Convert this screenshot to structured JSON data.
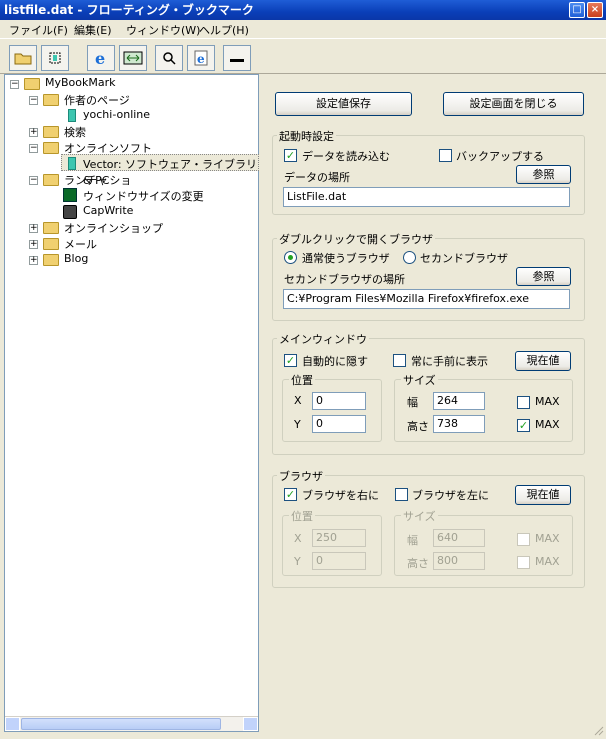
{
  "window": {
    "title": "listfile.dat - フローティング・ブックマーク"
  },
  "menu": [
    "ファイル(F)",
    "編集(E)",
    "ウィンドウ(W)",
    "ヘルプ(H)"
  ],
  "tree": {
    "root": "MyBookMark",
    "items": [
      {
        "label": "作者のページ"
      },
      {
        "label": "yochi-online"
      },
      {
        "label": "検索"
      },
      {
        "label": "オンラインソフト"
      },
      {
        "label": "Vector: ソフトウェア・ライブラリ & PCショ"
      },
      {
        "label": "ランチャ"
      },
      {
        "label": "ウィンドウサイズの変更"
      },
      {
        "label": "CapWrite"
      },
      {
        "label": "オンラインショップ"
      },
      {
        "label": "メール"
      },
      {
        "label": "Blog"
      }
    ]
  },
  "buttons": {
    "save": "設定値保存",
    "close": "設定画面を閉じる"
  },
  "startup": {
    "legend": "起動時設定",
    "load_data": "データを読み込む",
    "backup": "バックアップする",
    "data_location_label": "データの場所",
    "browse": "参照",
    "data_path": "ListFile.dat"
  },
  "dblclick": {
    "legend": "ダブルクリックで開くブラウザ",
    "normal_browser": "通常使うブラウザ",
    "second_browser": "セカンドブラウザ",
    "second_location_label": "セカンドブラウザの場所",
    "browse": "参照",
    "path": "C:¥Program Files¥Mozilla Firefox¥firefox.exe"
  },
  "main_window": {
    "legend": "メインウィンドウ",
    "auto_hide": "自動的に隠す",
    "always_front": "常に手前に表示",
    "current": "現在値",
    "position": "位置",
    "x_label": "X",
    "x": "0",
    "y_label": "Y",
    "y": "0",
    "size": "サイズ",
    "width_label": "幅",
    "width": "264",
    "height_label": "高さ",
    "height": "738",
    "max1": "MAX",
    "max2": "MAX"
  },
  "browser": {
    "legend": "ブラウザ",
    "right": "ブラウザを右に",
    "left": "ブラウザを左に",
    "current": "現在値",
    "position": "位置",
    "x_label": "X",
    "x": "250",
    "y_label": "Y",
    "y": "0",
    "size": "サイズ",
    "width_label": "幅",
    "width": "640",
    "height_label": "高さ",
    "height": "800",
    "max1": "MAX",
    "max2": "MAX"
  }
}
